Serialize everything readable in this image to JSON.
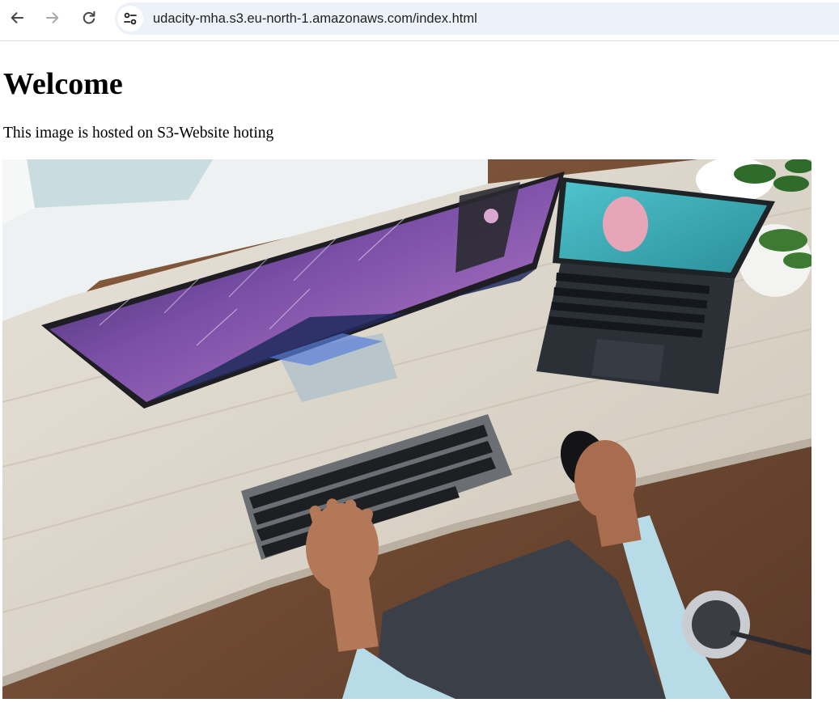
{
  "browser": {
    "url": "udacity-mha.s3.eu-north-1.amazonaws.com/index.html",
    "icons": {
      "back": "arrow-left-icon",
      "forward": "arrow-right-icon",
      "reload": "reload-icon",
      "site_info": "tune-icon"
    },
    "colors": {
      "omnibox_bg": "#edf2fa",
      "icon_active": "#474747",
      "icon_disabled": "#a8a8a8"
    }
  },
  "page": {
    "title": "Welcome",
    "text": "This image is hosted on S3-Website hoting",
    "image": {
      "description_icon": "photo-workspace-desk",
      "colors": {
        "desk": "#dcd6cc",
        "floor": "#6e4a34",
        "monitor_sky": "#7a4fa6",
        "laptop_screen": "#3fb6bf"
      }
    }
  }
}
